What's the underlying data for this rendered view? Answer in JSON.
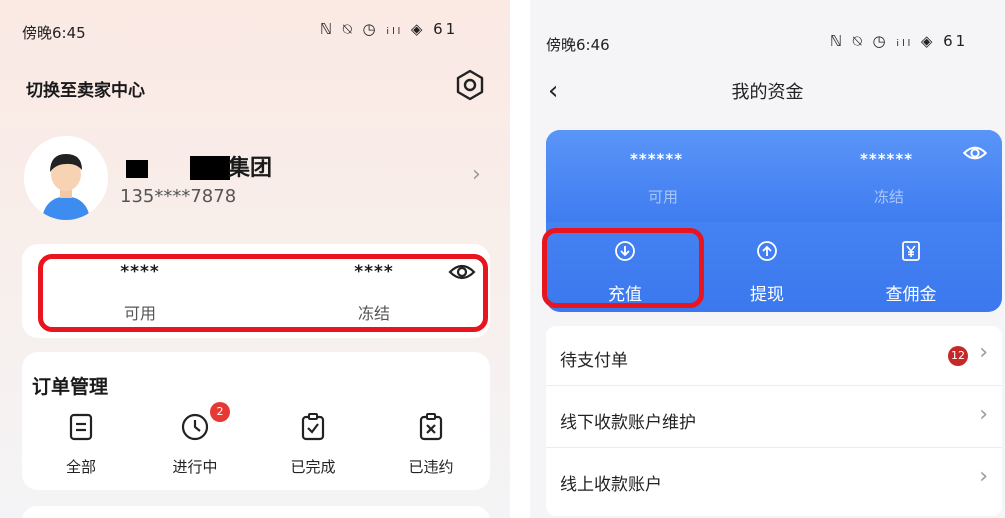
{
  "left_screen": {
    "status": {
      "time": "傍晚6:45",
      "icons": "ℕ ⍉ ◷ ᵢₗₗ ◈ 61"
    },
    "header": {
      "switch_label": "切换至卖家中心"
    },
    "profile": {
      "name_suffix": "集团",
      "phone": "135****7878"
    },
    "balance": {
      "available_value": "****",
      "available_label": "可用",
      "frozen_value": "****",
      "frozen_label": "冻结"
    },
    "orders": {
      "title": "订单管理",
      "items": [
        {
          "label": "全部",
          "icon": "list-icon"
        },
        {
          "label": "进行中",
          "icon": "clock-icon",
          "badge": "2"
        },
        {
          "label": "已完成",
          "icon": "clipboard-check-icon"
        },
        {
          "label": "已违约",
          "icon": "clipboard-x-icon"
        }
      ]
    }
  },
  "right_screen": {
    "status": {
      "time": "傍晚6:46",
      "icons": "ℕ ⍉ ◷ ᵢₗₗ ◈ 61"
    },
    "header": {
      "title": "我的资金"
    },
    "funds": {
      "available_value": "******",
      "available_label": "可用",
      "frozen_value": "******",
      "frozen_label": "冻结",
      "actions": [
        {
          "label": "充值",
          "icon": "download-circle-icon"
        },
        {
          "label": "提现",
          "icon": "upload-circle-icon"
        },
        {
          "label": "查佣金",
          "icon": "yen-icon"
        }
      ]
    },
    "list": [
      {
        "label": "待支付单",
        "badge": "12"
      },
      {
        "label": "线下收款账户维护"
      },
      {
        "label": "线上收款账户"
      }
    ]
  },
  "colors": {
    "highlight": "#e8141e",
    "fund_blue": "#3b78ee",
    "badge_red": "#e53935"
  }
}
